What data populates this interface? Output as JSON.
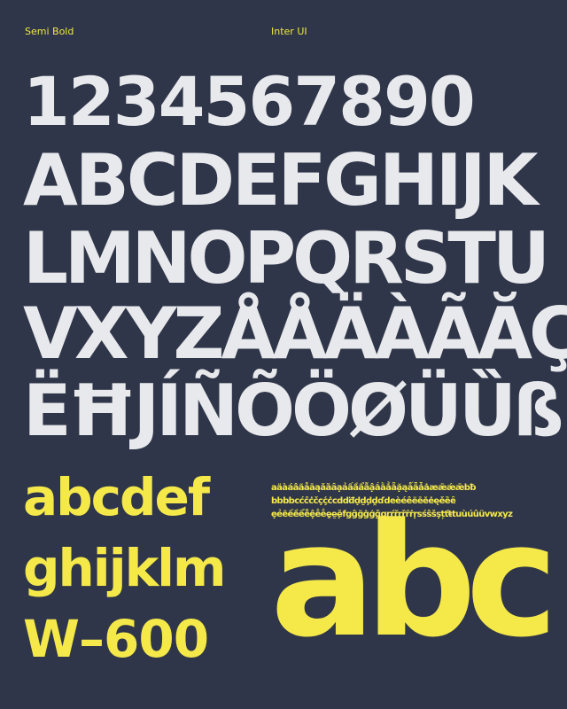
{
  "header": {
    "weight": "Semi Bold",
    "family": "Inter UI"
  },
  "specimen": {
    "digits": "1234567890",
    "upper_1": "ABCDEFGHIJK",
    "upper_2": "LMNOPQRSTU",
    "upper_3": "VXYZÅÅÄÀÃĂÇ",
    "upper_4": "ËĦJÍÑÕÖØÜȔß",
    "lower_1": "abcdef",
    "lower_2": "ghijklm",
    "weight_code": "W–600",
    "extended_1": "aäàáâãåāąǎȁȃạảấầẩẫậắằẳẵặąǻǟǡȧæǣǽǣbƀ",
    "extended_2": "bbbbcćĉċčçḉċcdďđḍḏḑḓɗdeèéêëēĕėęěȅȇ",
    "extended_3": "ẹẻẽếềểễệḕḗḙḛḝfgĝğġģǧqrŕřŗȑȓṙṛsśŝšşțťŧtuùúûüvwxyz",
    "big_sample": "abc"
  },
  "colors": {
    "background": "#2f3649",
    "primary_text": "#e8e9ec",
    "accent": "#f5e94a"
  }
}
